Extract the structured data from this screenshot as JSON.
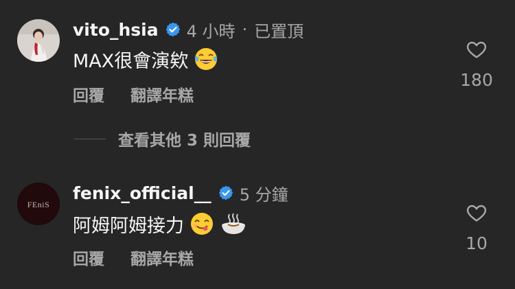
{
  "comments": [
    {
      "username": "vito_hsia",
      "time": "4 小時",
      "separator": "·",
      "pinned": "已置頂",
      "text": "MAX很會演欸",
      "emojis": [
        "face-with-tears-of-joy"
      ],
      "reply_label": "回覆",
      "translate_label": "翻譯年糕",
      "likes": "180",
      "verified": true
    },
    {
      "username": "fenix_official__",
      "time": "5 分鐘",
      "text": "阿姆阿姆接力",
      "emojis": [
        "face-savoring-food",
        "steaming-bowl"
      ],
      "reply_label": "回覆",
      "translate_label": "翻譯年糕",
      "likes": "10",
      "verified": true,
      "avatar_text": "FEniS"
    }
  ],
  "view_more_replies": "查看其他 3 則回覆",
  "colors": {
    "background": "#262626",
    "primary_text": "#f5f5f5",
    "secondary_text": "#a8a8a8",
    "verified_blue": "#3897f0"
  }
}
